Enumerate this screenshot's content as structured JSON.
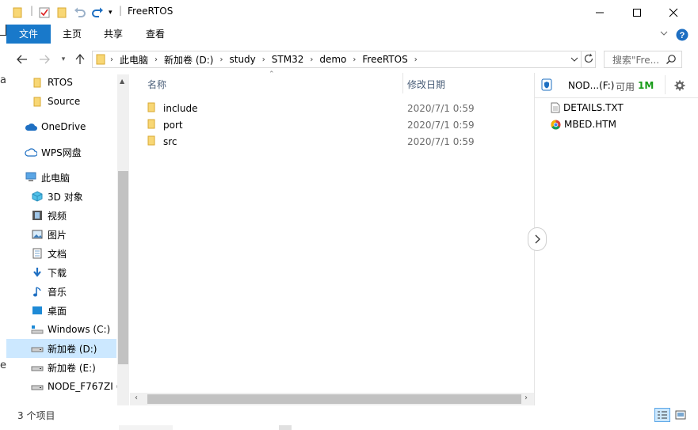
{
  "window": {
    "title": "FreeRTOS"
  },
  "ribbon": {
    "tabs": [
      {
        "label": "文件"
      },
      {
        "label": "主页"
      },
      {
        "label": "共享"
      },
      {
        "label": "查看"
      }
    ]
  },
  "address": {
    "crumbs": [
      "此电脑",
      "新加卷 (D:)",
      "study",
      "STM32",
      "demo",
      "FreeRTOS"
    ]
  },
  "search": {
    "placeholder": "搜索\"Fre..."
  },
  "sidebar": {
    "items": [
      {
        "label": "RTOS",
        "icon": "folder-icon"
      },
      {
        "label": "Source",
        "icon": "folder-icon"
      },
      {
        "label": "OneDrive",
        "icon": "cloud-icon"
      },
      {
        "label": "WPS网盘",
        "icon": "wps-cloud-icon"
      },
      {
        "label": "此电脑",
        "icon": "computer-icon"
      },
      {
        "label": "3D 对象",
        "icon": "cube-icon"
      },
      {
        "label": "视频",
        "icon": "video-icon"
      },
      {
        "label": "图片",
        "icon": "picture-icon"
      },
      {
        "label": "文档",
        "icon": "document-icon"
      },
      {
        "label": "下载",
        "icon": "download-icon"
      },
      {
        "label": "音乐",
        "icon": "music-icon"
      },
      {
        "label": "桌面",
        "icon": "desktop-icon"
      },
      {
        "label": "Windows (C:)",
        "icon": "drive-icon"
      },
      {
        "label": "新加卷 (D:)",
        "icon": "drive-icon"
      },
      {
        "label": "新加卷 (E:)",
        "icon": "drive-icon"
      },
      {
        "label": "NODE_F767ZI (",
        "icon": "drive-icon"
      }
    ],
    "selected_label": "新加卷 (D:)"
  },
  "filelist": {
    "columns": {
      "name": "名称",
      "modified": "修改日期"
    },
    "rows": [
      {
        "name": "include",
        "modified": "2020/7/1 0:59"
      },
      {
        "name": "port",
        "modified": "2020/7/1 0:59"
      },
      {
        "name": "src",
        "modified": "2020/7/1 0:59"
      }
    ]
  },
  "right_pane": {
    "drive_label": "NOD...(F:)",
    "free_label": "可用",
    "free_value": "1M",
    "items": [
      {
        "name": "DETAILS.TXT",
        "icon": "text-file-icon"
      },
      {
        "name": "MBED.HTM",
        "icon": "chrome-icon"
      }
    ]
  },
  "status": {
    "count_text": "3 个项目"
  },
  "colors": {
    "accent": "#1979ca",
    "selection": "#cce8ff",
    "folder": "#f8d775",
    "free_space": "#1a9c1a"
  }
}
